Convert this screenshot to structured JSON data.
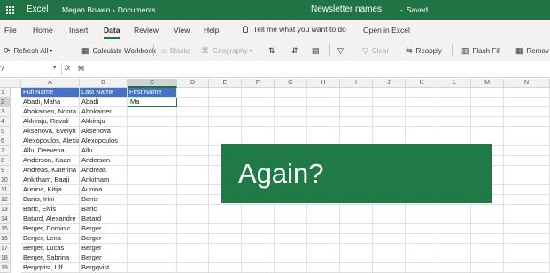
{
  "title_bar": {
    "app_name": "Excel",
    "breadcrumb": [
      "Megan Bowen",
      "Documents"
    ],
    "breadcrumb_separator": "›",
    "document_name": "Newsletter names",
    "status": "Saved",
    "status_dash": "-"
  },
  "menu": {
    "items": [
      "File",
      "Home",
      "Insert",
      "Data",
      "Review",
      "View",
      "Help"
    ],
    "active": "Data",
    "tell_me": "Tell me what you want to do",
    "open_in": "Open in Excel"
  },
  "ribbon": {
    "refresh_all": "Refresh All",
    "calculate_workbook": "Calculate Workbook",
    "stocks": "Stocks",
    "geography": "Geography",
    "clear": "Clear",
    "reapply": "Reapply",
    "flash_fill": "Flash Fill",
    "remove": "Remov"
  },
  "formula_bar": {
    "name_box": "?",
    "fx": "fx",
    "value": "M"
  },
  "grid": {
    "columns": [
      "A",
      "B",
      "C",
      "D",
      "E",
      "F",
      "G",
      "H",
      "I",
      "J",
      "K",
      "L",
      "M",
      "N"
    ],
    "selected_column": "C",
    "rows": [
      "1",
      "2",
      "3",
      "4",
      "5",
      "6",
      "7",
      "8",
      "9",
      "10",
      "11",
      "12",
      "13",
      "14",
      "15",
      "16",
      "17",
      "18",
      "19"
    ],
    "selected_row": "2",
    "headers": [
      "Full Name",
      "Last Name",
      "First Name"
    ],
    "data": [
      [
        "Abadi, Maha",
        "Abadi",
        "Ma"
      ],
      [
        "Ahokainen, Noora",
        "Ahokainen",
        ""
      ],
      [
        "Akkiraju, Ravali",
        "Akkiraju",
        ""
      ],
      [
        "Aksenova, Evelyn",
        "Aksenova",
        ""
      ],
      [
        "Alexopoulos, Alexia",
        "Alexopoulos",
        ""
      ],
      [
        "Allu, Deevena",
        "Allu",
        ""
      ],
      [
        "Anderson, Kaari",
        "Anderson",
        ""
      ],
      [
        "Andreas, Katerina",
        "Andreas",
        ""
      ],
      [
        "Ankitham, Baaji",
        "Ankitham",
        ""
      ],
      [
        "Aunina, Kitija",
        "Aunina",
        ""
      ],
      [
        "Banis, Irini",
        "Banis",
        ""
      ],
      [
        "Baric, Elvis",
        "Baric",
        ""
      ],
      [
        "Batard, Alexandre",
        "Batard",
        ""
      ],
      [
        "Berger, Dominic",
        "Berger",
        ""
      ],
      [
        "Berger, Lena",
        "Berger",
        ""
      ],
      [
        "Berger, Lucas",
        "Berger",
        ""
      ],
      [
        "Berger, Sabrina",
        "Berger",
        ""
      ],
      [
        "Bergqvist, Ulf",
        "Bergqvist",
        ""
      ]
    ]
  },
  "overlay_text": "Again?",
  "colors": {
    "brand": "#217346",
    "header_fill": "#4472c4",
    "overlay": "#1f7a45"
  }
}
